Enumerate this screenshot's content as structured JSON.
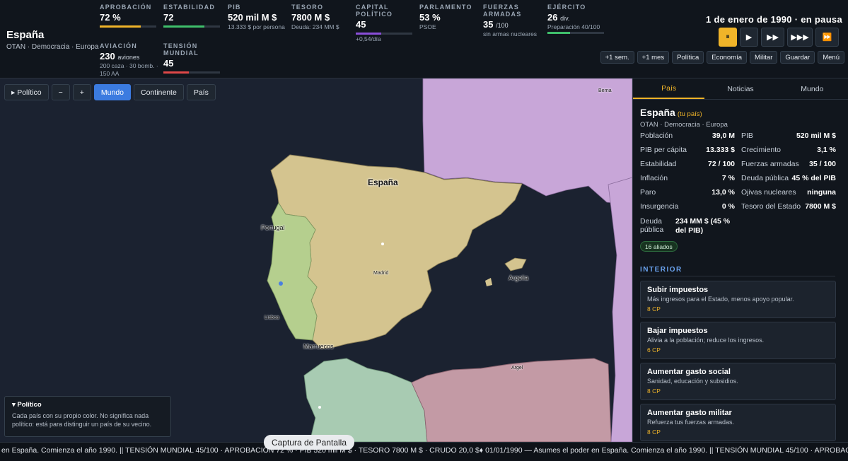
{
  "country": {
    "name": "España",
    "subtitle": "OTAN · Democracia · Europa"
  },
  "stats": [
    {
      "label": "APROBACIÓN",
      "value": "72 %",
      "sub": "",
      "fill": 0.72,
      "color": "#f0b429"
    },
    {
      "label": "ESTABILIDAD",
      "value": "72",
      "sub": "",
      "fill": 0.72,
      "color": "#3fbf6b"
    },
    {
      "label": "PIB",
      "value": "520 mil M $",
      "sub": "13.333 $ por persona"
    },
    {
      "label": "TESORO",
      "value": "7800 M $",
      "sub": "Deuda: 234 MM $"
    },
    {
      "label": "CAPITAL POLÍTICO",
      "value": "45",
      "sub": "+0,54/día",
      "fill": 0.45,
      "color": "#8a4fd8"
    },
    {
      "label": "PARLAMENTO",
      "value": "53 %",
      "sub": "PSOE"
    },
    {
      "label": "FUERZAS ARMADAS",
      "value": "35",
      "unit": "/100",
      "sub": "sin armas nucleares"
    },
    {
      "label": "EJÉRCITO",
      "value": "26",
      "unit": "div.",
      "sub": "Preparación 40/100",
      "fill": 0.4,
      "color": "#3fbf6b"
    },
    {
      "label": "AVIACIÓN",
      "value": "230",
      "unit": "aviones",
      "sub": "200 caza · 30 bomb. · 150 AA"
    },
    {
      "label": "TENSIÓN MUNDIAL",
      "value": "45",
      "sub": "",
      "fill": 0.45,
      "color": "#e04848"
    }
  ],
  "date_status": "1 de enero de 1990 · en pausa",
  "speed_buttons": [
    "⏸",
    "▶",
    "▶▶",
    "▶▶▶",
    "⏩"
  ],
  "action_buttons": [
    "+1 sem.",
    "+1 mes",
    "Política",
    "Economía",
    "Militar",
    "Guardar",
    "Menú"
  ],
  "map_toolbar": [
    "▸ Político",
    "−",
    "+",
    "Mundo",
    "Continente",
    "País"
  ],
  "map_toolbar_active": "Mundo",
  "map_labels": [
    "Berna",
    "España",
    "Portugal",
    "Madrid",
    "Argelia",
    "Lisboa",
    "Marruecos",
    "Argel"
  ],
  "legend": {
    "title": "▾ Político",
    "text": "Cada país con su propio color. No significa nada político: está para distinguir un país de su vecino."
  },
  "capture_button": "Captura de Pantalla",
  "ticker": "en España. Comienza el año 1990. || TENSIÓN MUNDIAL 45/100 · APROBACIÓN 72 % · PIB 520 mil M $ · TESORO 7800 M $ · CRUDO 20,0 $♦ 01/01/1990 — Asumes el poder en España. Comienza el año 1990. || TENSIÓN MUNDIAL 45/100 · APROBACIÓN 72 % · PIB",
  "panel": {
    "tabs": [
      "País",
      "Noticias",
      "Mundo"
    ],
    "active_tab": "País",
    "name": "España",
    "you": "(tu país)",
    "subtitle": "OTAN · Democracia · Europa",
    "left_stats": [
      {
        "label": "Población",
        "value": "39,0 M"
      },
      {
        "label": "PIB per cápita",
        "value": "13.333 $"
      },
      {
        "label": "Estabilidad",
        "value": "72 / 100"
      },
      {
        "label": "Inflación",
        "value": "7 %"
      },
      {
        "label": "Paro",
        "value": "13,0 %"
      },
      {
        "label": "Insurgencia",
        "value": "0 %"
      },
      {
        "label": "Deuda pública",
        "value": "234 MM $ (45 % del PIB)"
      }
    ],
    "right_stats": [
      {
        "label": "PIB",
        "value": "520 mil M $"
      },
      {
        "label": "Crecimiento",
        "value": "3,1 %"
      },
      {
        "label": "Fuerzas armadas",
        "value": "35 / 100"
      },
      {
        "label": "Deuda pública",
        "value": "45 % del PIB"
      },
      {
        "label": "Ojivas nucleares",
        "value": "ninguna"
      },
      {
        "label": "Tesoro del Estado",
        "value": "7800 M $"
      }
    ],
    "allies": "16 aliados",
    "section_title": "INTERIOR",
    "cards": [
      {
        "title": "Subir impuestos",
        "desc": "Más ingresos para el Estado, menos apoyo popular.",
        "cost": "8 CP"
      },
      {
        "title": "Bajar impuestos",
        "desc": "Alivia a la población; reduce los ingresos.",
        "cost": "6 CP"
      },
      {
        "title": "Aumentar gasto social",
        "desc": "Sanidad, educación y subsidios.",
        "cost": "8 CP"
      },
      {
        "title": "Aumentar gasto militar",
        "desc": "Refuerza tus fuerzas armadas.",
        "cost": "8 CP"
      }
    ]
  },
  "colors": {
    "accent": "#f0b429",
    "active_blue": "#3b7be0",
    "sea": "#1b2230",
    "spain": "#d4c48f",
    "portugal": "#b5cf8e",
    "france": "#c8a6d8",
    "algeria": "#c39aa5",
    "morocco": "#a8cbb2"
  }
}
